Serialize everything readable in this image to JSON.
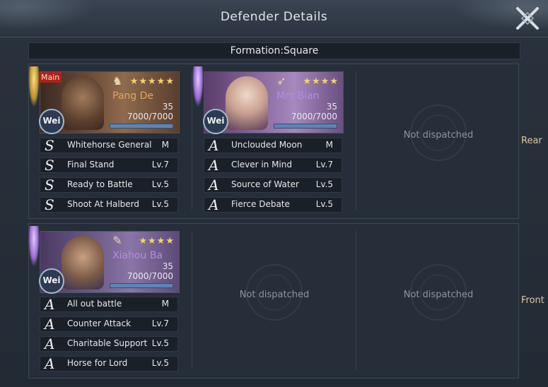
{
  "header": {
    "title": "Defender Details"
  },
  "formation": {
    "label": "Formation:Square"
  },
  "rows": {
    "rear_label": "Rear",
    "front_label": "Front"
  },
  "heroes": [
    {
      "name": "Pang De",
      "main_tag": "Main",
      "stars": "★★★★★",
      "level": "35",
      "troops": "7000/7000",
      "troop_fraction": 1.0,
      "faction": "Wei",
      "class_icon": "cavalry-icon",
      "skills": [
        {
          "grade": "S",
          "name": "Whitehorse General",
          "level": "M"
        },
        {
          "grade": "S",
          "name": "Final Stand",
          "level": "Lv.7"
        },
        {
          "grade": "S",
          "name": "Ready to Battle",
          "level": "Lv.5"
        },
        {
          "grade": "S",
          "name": "Shoot At Halberd",
          "level": "Lv.5"
        }
      ]
    },
    {
      "name": "Mrs Bian",
      "stars": "★★★★",
      "level": "35",
      "troops": "7000/7000",
      "troop_fraction": 1.0,
      "faction": "Wei",
      "class_icon": "bow-icon",
      "skills": [
        {
          "grade": "A",
          "name": "Unclouded Moon",
          "level": "M"
        },
        {
          "grade": "A",
          "name": "Clever in Mind",
          "level": "Lv.7"
        },
        {
          "grade": "A",
          "name": "Source of Water",
          "level": "Lv.5"
        },
        {
          "grade": "A",
          "name": "Fierce Debate",
          "level": "Lv.5"
        }
      ]
    },
    {
      "name": "Xiahou Ba",
      "stars": "★★★★",
      "level": "35",
      "troops": "7000/7000",
      "troop_fraction": 1.0,
      "faction": "Wei",
      "class_icon": "spear-icon",
      "skills": [
        {
          "grade": "A",
          "name": "All out battle",
          "level": "M"
        },
        {
          "grade": "A",
          "name": "Counter Attack",
          "level": "Lv.7"
        },
        {
          "grade": "A",
          "name": "Charitable Support",
          "level": "Lv.5"
        },
        {
          "grade": "A",
          "name": "Horse for Lord",
          "level": "Lv.5"
        }
      ]
    }
  ],
  "empty_slot": {
    "label": "Not dispatched"
  },
  "colors": {
    "accent_gold": "#e2a55a",
    "accent_purple": "#b58ae0",
    "star": "#f2d46a"
  }
}
